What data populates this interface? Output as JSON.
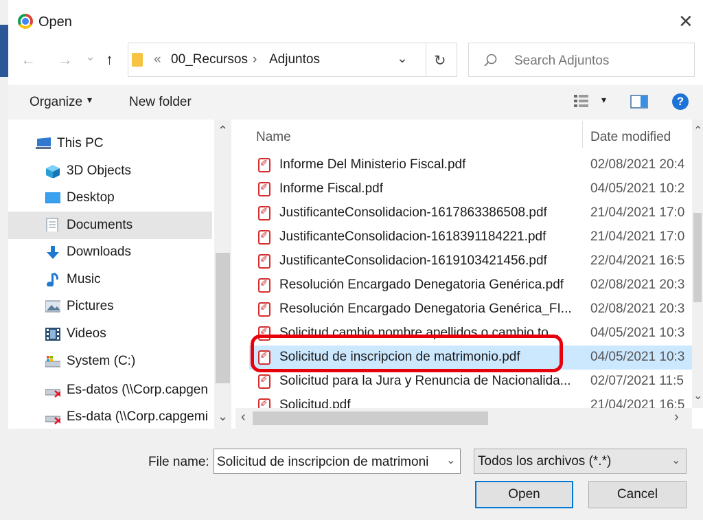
{
  "window": {
    "title": "Open",
    "close_glyph": "✕"
  },
  "nav": {
    "back": "←",
    "forward": "→",
    "recent": "⌄",
    "up": "↑"
  },
  "address": {
    "overflow": "«",
    "crumbs": [
      "00_Recursos",
      "Adjuntos"
    ],
    "separator": "›",
    "dropdown": "⌄",
    "refresh": "↻"
  },
  "search": {
    "placeholder": "Search Adjuntos",
    "icon": "search-icon"
  },
  "toolbar": {
    "organize": "Organize",
    "organize_caret": "▾",
    "new_folder": "New folder",
    "view_caret": "▾",
    "help": "?"
  },
  "sidebar": {
    "scroll_up": "⌃",
    "scroll_down": "⌄",
    "items": [
      {
        "label": "This PC",
        "icon": "computer-icon"
      },
      {
        "label": "3D Objects",
        "icon": "cube-icon"
      },
      {
        "label": "Desktop",
        "icon": "desktop-icon"
      },
      {
        "label": "Documents",
        "icon": "document-icon",
        "selected": true
      },
      {
        "label": "Downloads",
        "icon": "download-icon"
      },
      {
        "label": "Music",
        "icon": "music-icon"
      },
      {
        "label": "Pictures",
        "icon": "pictures-icon"
      },
      {
        "label": "Videos",
        "icon": "videos-icon"
      },
      {
        "label": "System (C:)",
        "icon": "drive-icon"
      },
      {
        "label": "Es-datos (\\\\Corp.capgen",
        "icon": "network-drive-icon"
      },
      {
        "label": "Es-data (\\\\Corp.capgemi",
        "icon": "network-drive-icon"
      }
    ]
  },
  "files": {
    "columns": {
      "name": "Name",
      "date": "Date modified"
    },
    "scroll_up": "⌃",
    "scroll_down": "⌄",
    "scroll_left": "‹",
    "scroll_right": "›",
    "rows": [
      {
        "name": "Informe Del Ministerio Fiscal.pdf",
        "date": "02/08/2021 20:4"
      },
      {
        "name": "Informe Fiscal.pdf",
        "date": "04/05/2021 10:2"
      },
      {
        "name": "JustificanteConsolidacion-1617863386508.pdf",
        "date": "21/04/2021 17:0"
      },
      {
        "name": "JustificanteConsolidacion-1618391184221.pdf",
        "date": "21/04/2021 17:0"
      },
      {
        "name": "JustificanteConsolidacion-1619103421456.pdf",
        "date": "22/04/2021 16:5"
      },
      {
        "name": "Resolución Encargado Denegatoria Genérica.pdf",
        "date": "02/08/2021 20:3"
      },
      {
        "name": "Resolución Encargado Denegatoria Genérica_FI...",
        "date": "02/08/2021 20:3"
      },
      {
        "name": "Solicitud cambio nombre apellidos o cambio to...",
        "date": "04/05/2021 10:3"
      },
      {
        "name": "Solicitud de inscripcion de matrimonio.pdf",
        "date": "04/05/2021 10:3",
        "highlighted": true
      },
      {
        "name": "Solicitud para la Jura y Renuncia de Nacionalida...",
        "date": "02/07/2021 11:5"
      },
      {
        "name": "Solicitud.pdf",
        "date": "21/04/2021 16:5"
      }
    ]
  },
  "footer": {
    "filename_label": "File name:",
    "filename_value": "Solicitud de inscripcion de matrimoni",
    "filename_caret": "⌄",
    "filetype_value": "Todos los archivos (*.*)",
    "filetype_caret": "⌄",
    "open_label": "Open",
    "cancel_label": "Cancel"
  },
  "colors": {
    "accent": "#0078d7",
    "highlight": "#cce8ff",
    "annotation": "#e8000b",
    "pdf": "#d32f2f"
  }
}
